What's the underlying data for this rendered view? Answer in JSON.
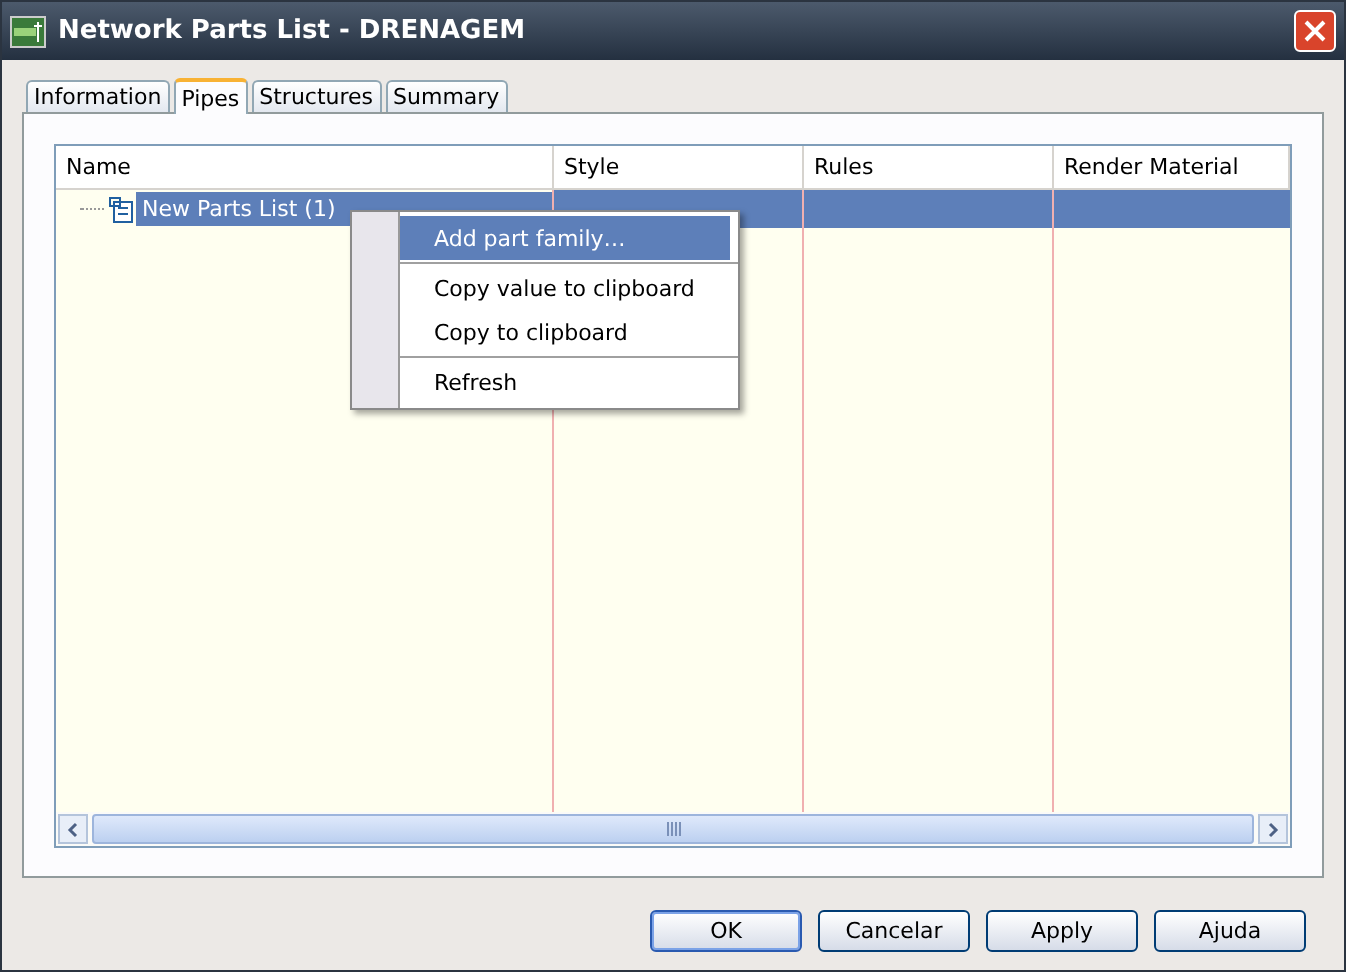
{
  "window": {
    "title": "Network Parts List - DRENAGEM"
  },
  "tabs": [
    {
      "label": "Information",
      "selected": false
    },
    {
      "label": "Pipes",
      "selected": true
    },
    {
      "label": "Structures",
      "selected": false
    },
    {
      "label": "Summary",
      "selected": false
    }
  ],
  "table": {
    "columns": [
      "Name",
      "Style",
      "Rules",
      "Render Material"
    ],
    "rows": [
      {
        "name": "New Parts List (1)",
        "selected": true
      }
    ]
  },
  "context_menu": {
    "items": [
      {
        "kind": "item",
        "label": "Add part family…",
        "selected": true
      },
      {
        "kind": "separator"
      },
      {
        "kind": "item",
        "label": "Copy value to clipboard",
        "selected": false
      },
      {
        "kind": "item",
        "label": "Copy to clipboard",
        "selected": false
      },
      {
        "kind": "separator"
      },
      {
        "kind": "item",
        "label": "Refresh",
        "selected": false
      }
    ]
  },
  "buttons": [
    {
      "label": "OK",
      "default": true
    },
    {
      "label": "Cancelar",
      "default": false
    },
    {
      "label": "Apply",
      "default": false
    },
    {
      "label": "Ajuda",
      "default": false
    }
  ]
}
